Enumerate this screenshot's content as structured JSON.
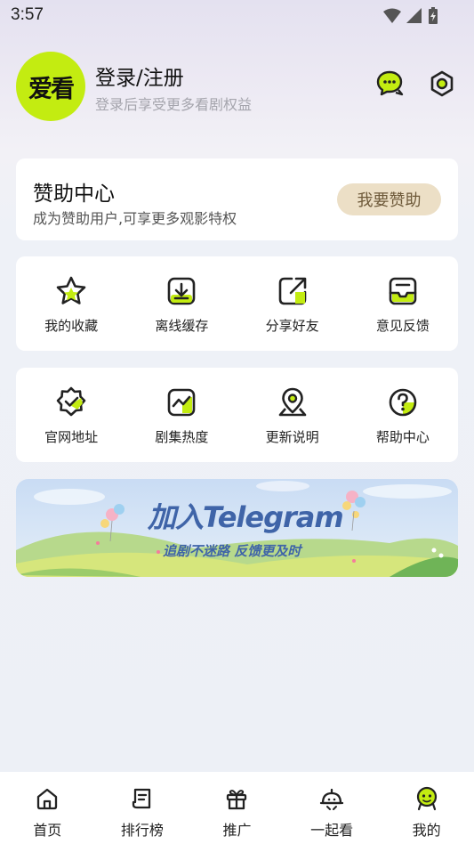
{
  "status_bar": {
    "time": "3:57"
  },
  "profile": {
    "avatar_text": "爱看",
    "title": "登录/注册",
    "subtitle": "登录后享受更多看剧权益"
  },
  "sponsor": {
    "title": "赞助中心",
    "subtitle": "成为赞助用户,可享更多观影特权",
    "button": "我要赞助"
  },
  "menu_row1": [
    {
      "label": "我的收藏",
      "icon": "star-icon"
    },
    {
      "label": "离线缓存",
      "icon": "download-icon"
    },
    {
      "label": "分享好友",
      "icon": "share-icon"
    },
    {
      "label": "意见反馈",
      "icon": "inbox-icon"
    }
  ],
  "menu_row2": [
    {
      "label": "官网地址",
      "icon": "badge-check-icon"
    },
    {
      "label": "剧集热度",
      "icon": "trend-chart-icon"
    },
    {
      "label": "更新说明",
      "icon": "location-pin-icon"
    },
    {
      "label": "帮助中心",
      "icon": "help-icon"
    }
  ],
  "banner": {
    "title": "加入Telegram",
    "subtitle": "追剧不迷路 反馈更及时"
  },
  "tabs": [
    {
      "label": "首页",
      "icon": "home-icon"
    },
    {
      "label": "排行榜",
      "icon": "ranking-icon"
    },
    {
      "label": "推广",
      "icon": "gift-icon"
    },
    {
      "label": "一起看",
      "icon": "watch-together-icon"
    },
    {
      "label": "我的",
      "icon": "profile-face-icon"
    }
  ],
  "colors": {
    "accent": "#c3ec11",
    "sponsor_button_bg": "#ecdfc6",
    "banner_text": "#3f64a8"
  }
}
